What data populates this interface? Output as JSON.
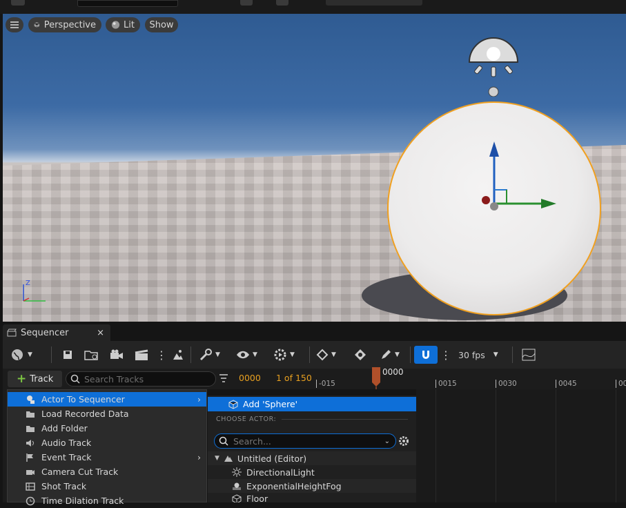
{
  "viewport": {
    "buttons": {
      "perspective": "Perspective",
      "lit": "Lit",
      "show": "Show"
    },
    "axes": {
      "z": "Z"
    }
  },
  "sequencer": {
    "tab_label": "Sequencer",
    "fps": "30 fps",
    "track_button": "Track",
    "search_placeholder": "Search Tracks",
    "current_frame": "0000",
    "frame_count": "1 of 150",
    "playhead_label": "0000",
    "ruler": [
      "-015",
      "0015",
      "0030",
      "0045",
      "00"
    ]
  },
  "track_menu": {
    "items": [
      {
        "label": "Actor To Sequencer",
        "submenu": true,
        "icon": "actor-icon"
      },
      {
        "label": "Load Recorded Data",
        "submenu": false,
        "icon": "folder-icon"
      },
      {
        "label": "Add Folder",
        "submenu": false,
        "icon": "folder-icon"
      },
      {
        "label": "Audio Track",
        "submenu": false,
        "icon": "audio-icon"
      },
      {
        "label": "Event Track",
        "submenu": true,
        "icon": "flag-icon"
      },
      {
        "label": "Camera Cut Track",
        "submenu": false,
        "icon": "camera-cut-icon"
      },
      {
        "label": "Shot Track",
        "submenu": false,
        "icon": "shot-icon"
      },
      {
        "label": "Time Dilation Track",
        "submenu": false,
        "icon": "time-icon"
      }
    ]
  },
  "actor_submenu": {
    "add_label": "Add 'Sphere'",
    "section_header": "CHOOSE ACTOR:",
    "search_placeholder": "Search...",
    "tree": {
      "root": "Untitled (Editor)",
      "children": [
        "DirectionalLight",
        "ExponentialHeightFog",
        "Floor"
      ]
    }
  },
  "colors": {
    "accent": "#0e6fd8",
    "selection_outline": "#f0a020",
    "timecode": "#e8a020"
  }
}
